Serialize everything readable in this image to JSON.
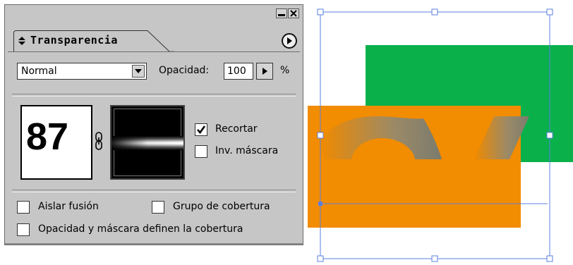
{
  "panel": {
    "tab_label": "Transparencia",
    "blend_mode": {
      "selected": "Normal"
    },
    "opacity": {
      "label": "Opacidad:",
      "value": "100",
      "unit": "%"
    },
    "artwork_thumbnail_text": "87",
    "checkboxes": {
      "recortar": {
        "label": "Recortar",
        "checked": true
      },
      "inv_mascara": {
        "label": "Inv. máscara",
        "checked": false
      },
      "aislar_fusion": {
        "label": "Aislar fusión",
        "checked": false
      },
      "grupo_cobertura": {
        "label": "Grupo de cobertura",
        "checked": false
      },
      "opacidad_mascara": {
        "label": "Opacidad y máscara definen la cobertura",
        "checked": false
      }
    }
  },
  "colors": {
    "green": "#0ab14b",
    "orange": "#f28c00",
    "selection": "#5b7fe0",
    "panel_bg": "#c6c6c6"
  }
}
